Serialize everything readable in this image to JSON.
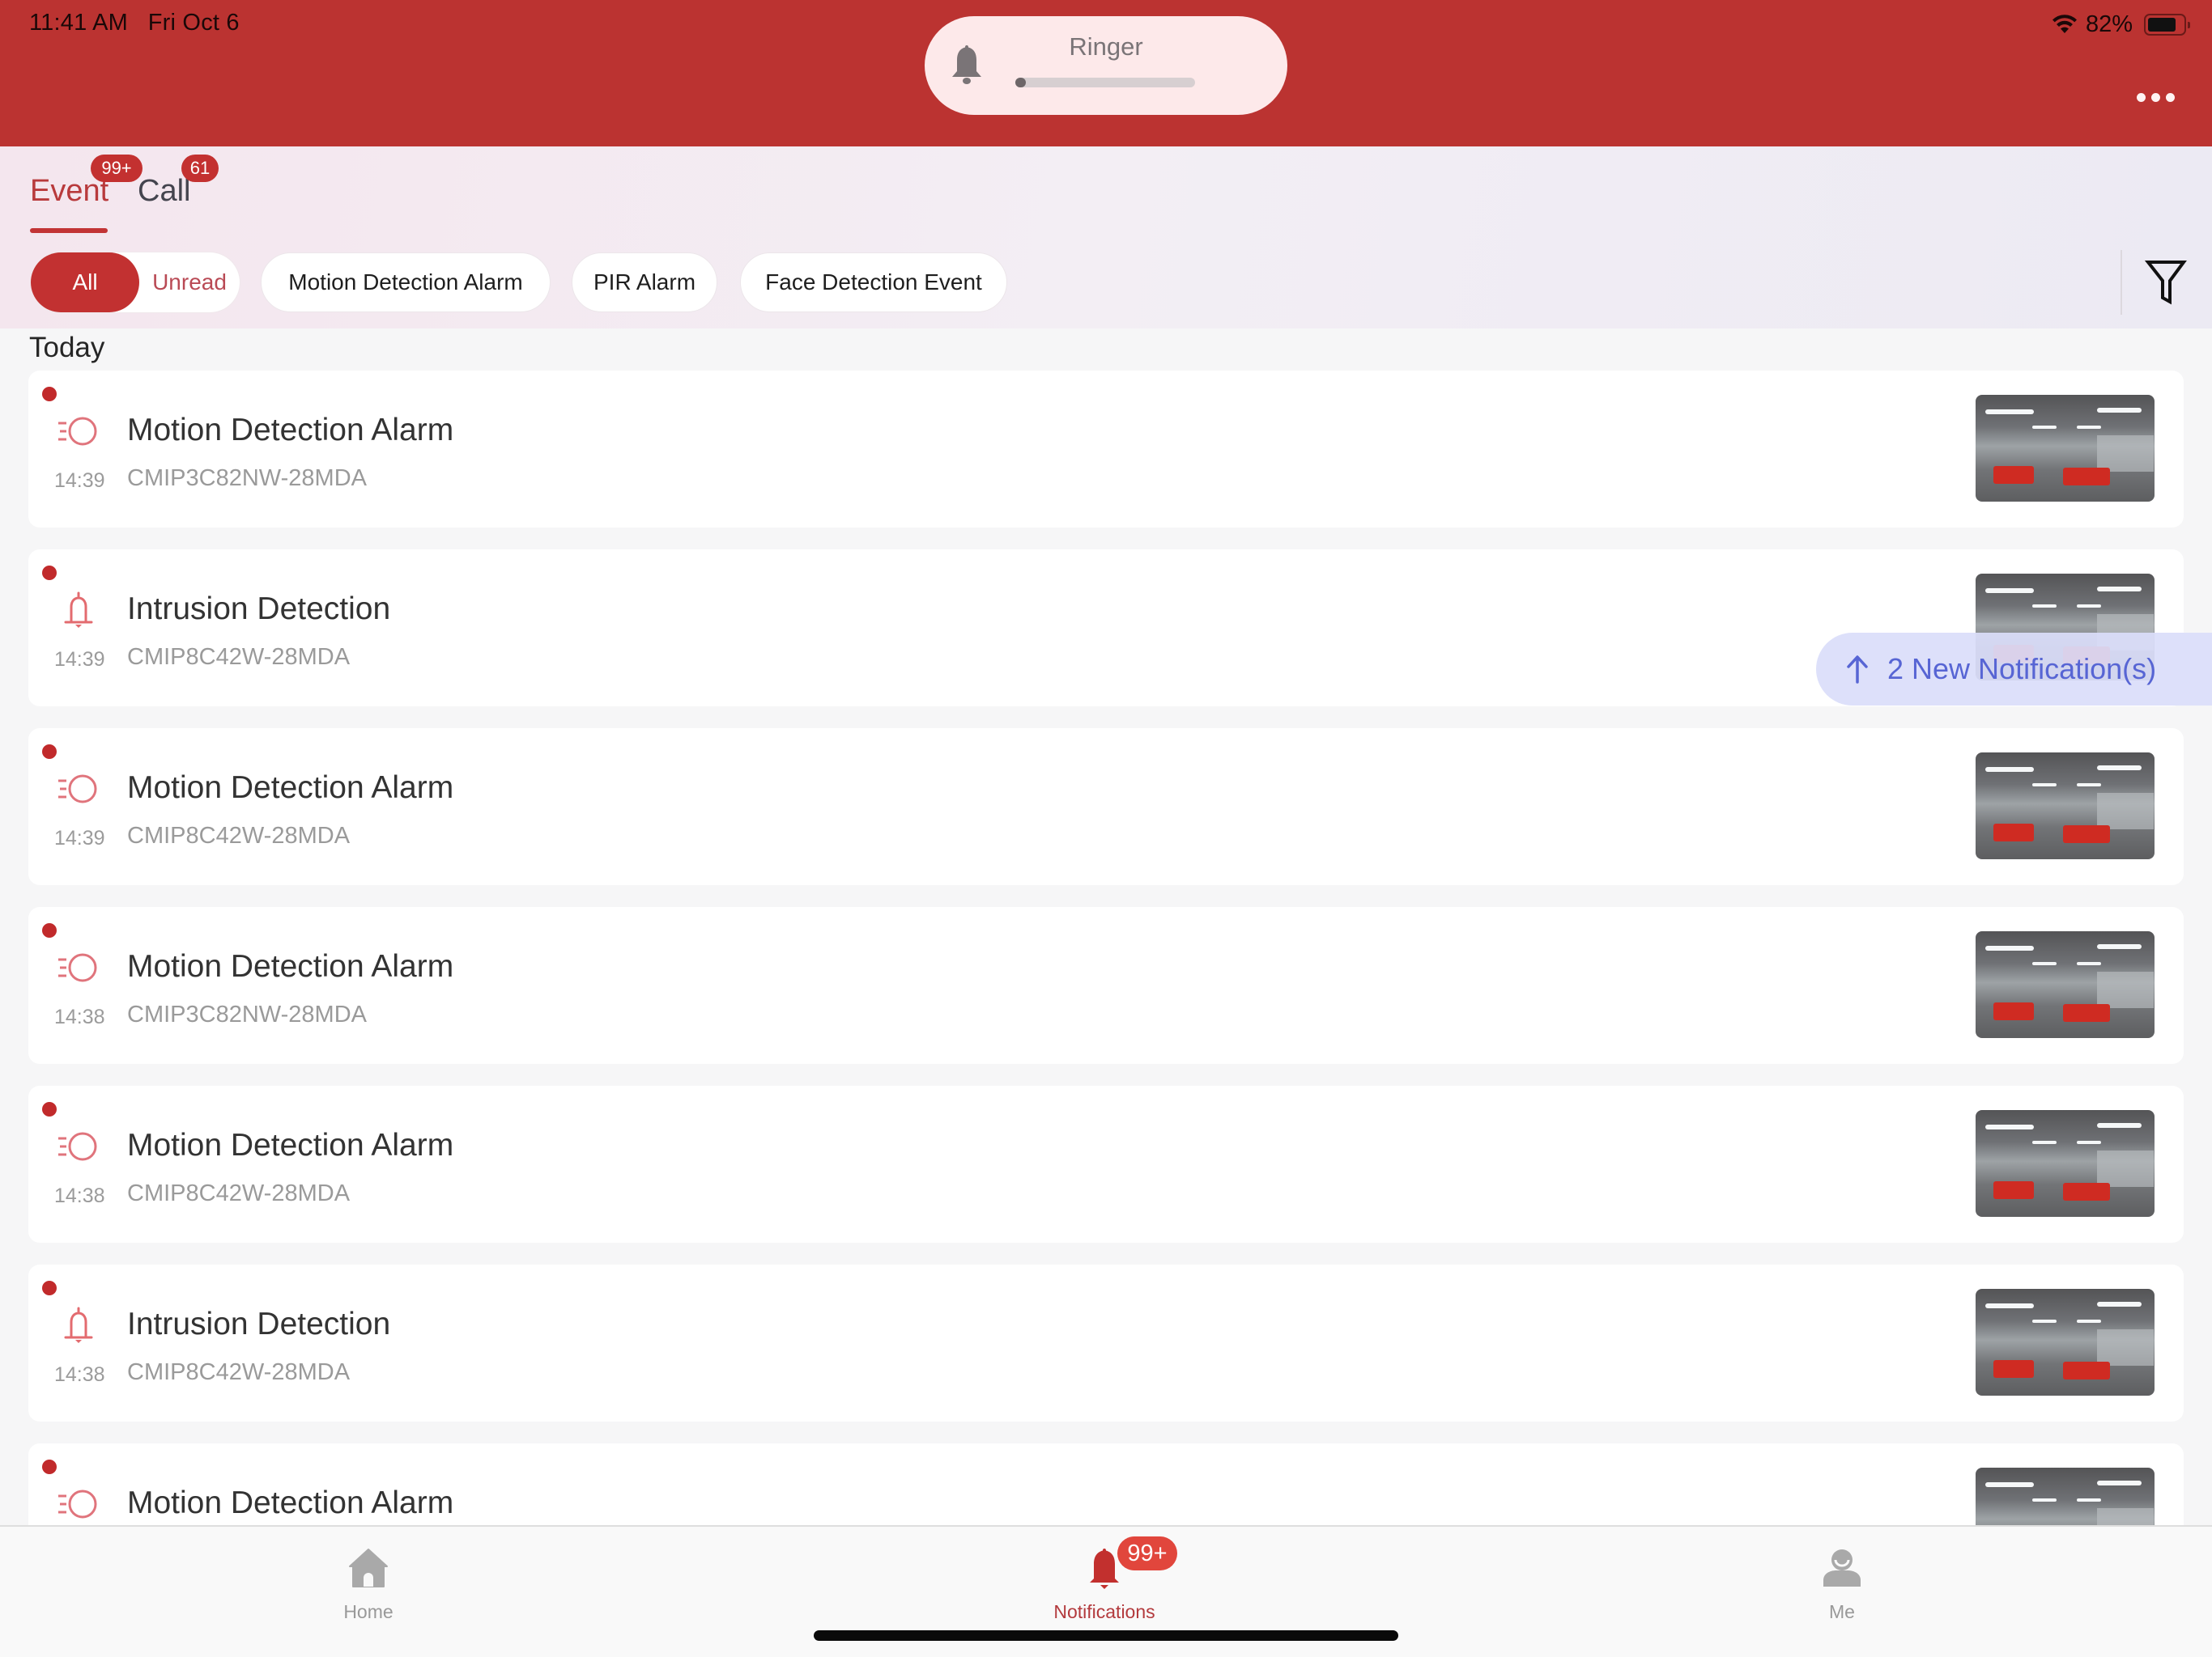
{
  "status_bar": {
    "time": "11:41 AM",
    "date": "Fri Oct 6",
    "battery_percent_label": "82%",
    "battery_level": 0.82,
    "wifi": "wifi-icon"
  },
  "ringer_hud": {
    "label": "Ringer",
    "icon": "bell-icon",
    "volume_level": 0.04
  },
  "header": {
    "more_icon": "ellipsis-icon"
  },
  "tabs": [
    {
      "label": "Event",
      "badge": "99+",
      "active": true
    },
    {
      "label": "Call",
      "badge": "61",
      "active": false
    }
  ],
  "filters": {
    "segment": [
      {
        "label": "All",
        "selected": true
      },
      {
        "label": "Unread",
        "selected": false
      }
    ],
    "chips": [
      {
        "label": "Motion Detection Alarm"
      },
      {
        "label": "PIR Alarm"
      },
      {
        "label": "Face Detection Event"
      }
    ],
    "filter_icon": "funnel-icon"
  },
  "section_label": "Today",
  "events": [
    {
      "title": "Motion Detection Alarm",
      "time": "14:39",
      "device": "CMIP3C82NW-28MDA",
      "type": "motion",
      "unread": true
    },
    {
      "title": "Intrusion Detection",
      "time": "14:39",
      "device": "CMIP8C42W-28MDA",
      "type": "intrusion",
      "unread": true
    },
    {
      "title": "Motion Detection Alarm",
      "time": "14:39",
      "device": "CMIP8C42W-28MDA",
      "type": "motion",
      "unread": true
    },
    {
      "title": "Motion Detection Alarm",
      "time": "14:38",
      "device": "CMIP3C82NW-28MDA",
      "type": "motion",
      "unread": true
    },
    {
      "title": "Motion Detection Alarm",
      "time": "14:38",
      "device": "CMIP8C42W-28MDA",
      "type": "motion",
      "unread": true
    },
    {
      "title": "Intrusion Detection",
      "time": "14:38",
      "device": "CMIP8C42W-28MDA",
      "type": "intrusion",
      "unread": true
    },
    {
      "title": "Motion Detection Alarm",
      "time": "",
      "device": "",
      "type": "motion",
      "unread": true
    }
  ],
  "toast": {
    "label": "2 New Notification(s)",
    "icon": "arrow-up-icon"
  },
  "bottom_nav": [
    {
      "label": "Home",
      "icon": "home-icon",
      "active": false
    },
    {
      "label": "Notifications",
      "icon": "bell-icon",
      "badge": "99+",
      "active": true
    },
    {
      "label": "Me",
      "icon": "person-icon",
      "active": false
    }
  ],
  "colors": {
    "brand_red": "#bb3331",
    "accent_red": "#c23131",
    "toast_text": "#5765d4",
    "toast_bg": "#dadefa"
  }
}
